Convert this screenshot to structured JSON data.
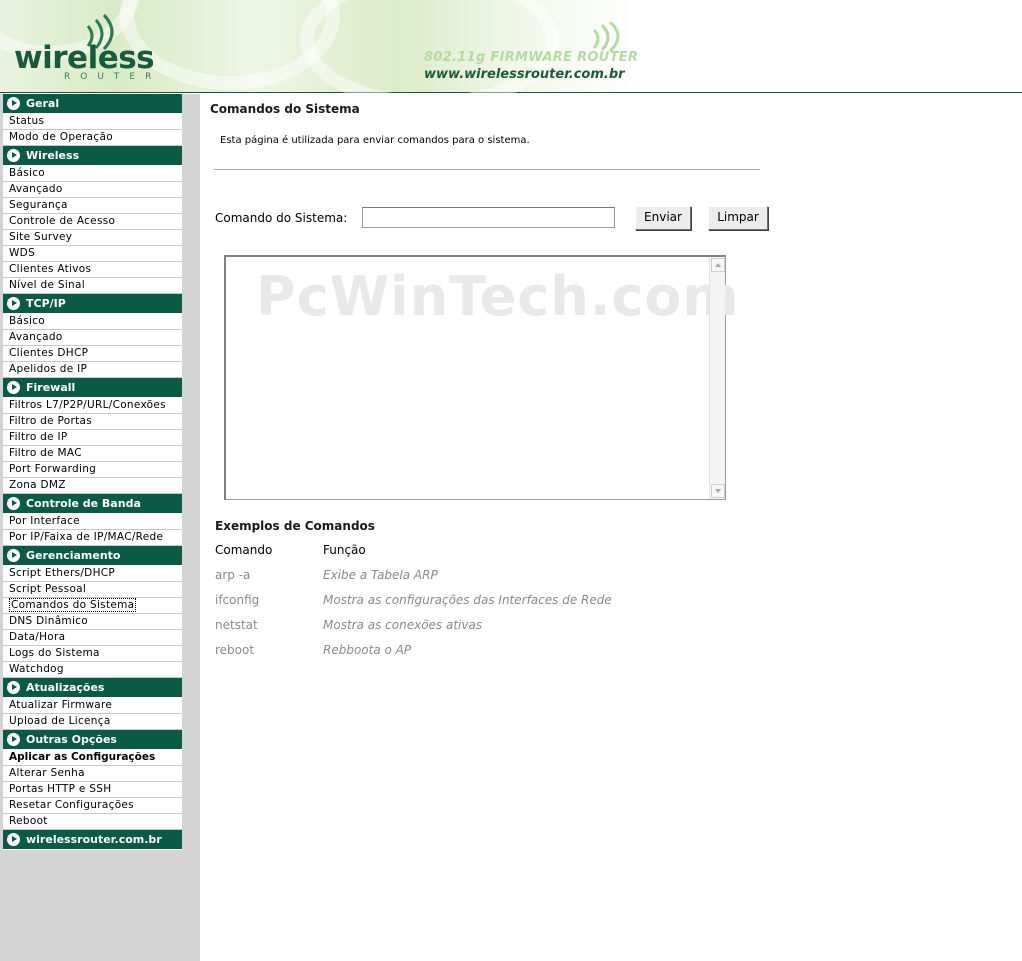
{
  "header": {
    "logo_main": "wireless",
    "logo_sub": "ROUTER",
    "tagline_1": "802.11g FIRMWARE ROUTER",
    "tagline_2": "www.wirelessrouter.com.br",
    "icons": [
      "wifi-waves-icon"
    ]
  },
  "sidebar": {
    "sections": [
      {
        "title": "Geral",
        "items": [
          "Status",
          "Modo de Operação"
        ]
      },
      {
        "title": "Wireless",
        "items": [
          "Básico",
          "Avançado",
          "Segurança",
          "Controle de Acesso",
          "Site Survey",
          "WDS",
          "Clientes Ativos",
          "Nível de Sinal"
        ]
      },
      {
        "title": "TCP/IP",
        "items": [
          "Básico",
          "Avançado",
          "Clientes DHCP",
          "Apelidos de IP"
        ]
      },
      {
        "title": "Firewall",
        "items": [
          "Filtros L7/P2P/URL/Conexões",
          "Filtro de Portas",
          "Filtro de IP",
          "Filtro de MAC",
          "Port Forwarding",
          "Zona DMZ"
        ]
      },
      {
        "title": "Controle de Banda",
        "items": [
          "Por Interface",
          "Por IP/Faixa de IP/MAC/Rede"
        ]
      },
      {
        "title": "Gerenciamento",
        "items": [
          "Script Ethers/DHCP",
          "Script Pessoal",
          "Comandos do Sistema",
          "DNS Dinâmico",
          "Data/Hora",
          "Logs do Sistema",
          "Watchdog"
        ]
      },
      {
        "title": "Atualizações",
        "items": [
          "Atualizar Firmware",
          "Upload de Licença"
        ]
      },
      {
        "title": "Outras Opções",
        "items": [
          "Aplicar as Configurações",
          "Alterar Senha",
          "Portas HTTP e SSH",
          "Resetar Configurações",
          "Reboot"
        ]
      },
      {
        "title": "wirelessrouter.com.br",
        "items": []
      }
    ],
    "current_item": "Comandos do Sistema",
    "bold_item": "Aplicar as Configurações",
    "section_icon": "arrow-right-circle-icon"
  },
  "main": {
    "title": "Comandos do Sistema",
    "description": "Esta página é utilizada para enviar comandos para o sistema.",
    "command_label": "Comando do Sistema:",
    "command_value": "",
    "send_label": "Enviar",
    "clear_label": "Limpar",
    "output_text": "",
    "watermark": "PcWinTech.com",
    "examples_title": "Exemplos de Comandos",
    "examples_header": {
      "command": "Comando",
      "function": "Função"
    },
    "examples": [
      {
        "command": "arp -a",
        "function": "Exibe a Tabela ARP"
      },
      {
        "command": "ifconfig",
        "function": "Mostra as configurações das Interfaces de Rede"
      },
      {
        "command": "netstat",
        "function": "Mostra as conexões ativas"
      },
      {
        "command": "reboot",
        "function": "Rebboota o AP"
      }
    ]
  },
  "colors": {
    "menu_section_bg": "#0a5a45",
    "sidebar_bg": "#d4d4d4",
    "brand_green": "#1a5a3c"
  }
}
